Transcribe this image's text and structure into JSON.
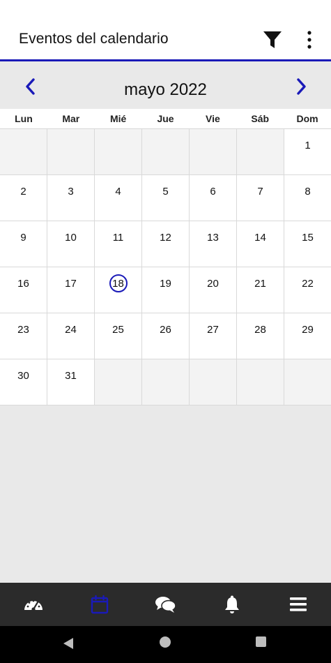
{
  "app_bar": {
    "title": "Eventos del calendario",
    "filter_icon": "filter-icon",
    "more_icon": "more-vertical-icon"
  },
  "calendar": {
    "month_label": "mayo 2022",
    "prev_icon": "chevron-left-icon",
    "next_icon": "chevron-right-icon",
    "weekdays": [
      "Lun",
      "Mar",
      "Mié",
      "Jue",
      "Vie",
      "Sáb",
      "Dom"
    ],
    "weeks": [
      [
        "",
        "",
        "",
        "",
        "",
        "",
        "1"
      ],
      [
        "2",
        "3",
        "4",
        "5",
        "6",
        "7",
        "8"
      ],
      [
        "9",
        "10",
        "11",
        "12",
        "13",
        "14",
        "15"
      ],
      [
        "16",
        "17",
        "18",
        "19",
        "20",
        "21",
        "22"
      ],
      [
        "23",
        "24",
        "25",
        "26",
        "27",
        "28",
        "29"
      ],
      [
        "30",
        "31",
        "",
        "",
        "",
        "",
        ""
      ]
    ],
    "today": "18"
  },
  "bottom_nav": {
    "items": [
      {
        "icon": "dashboard-gauge-icon",
        "active": false
      },
      {
        "icon": "calendar-icon",
        "active": true
      },
      {
        "icon": "chat-icon",
        "active": false
      },
      {
        "icon": "bell-icon",
        "active": false
      },
      {
        "icon": "menu-icon",
        "active": false
      }
    ]
  },
  "colors": {
    "accent": "#1a1ab8",
    "nav_background": "#2b2b2b",
    "nav_icon": "#ffffff",
    "empty_cell": "#f3f3f3"
  }
}
